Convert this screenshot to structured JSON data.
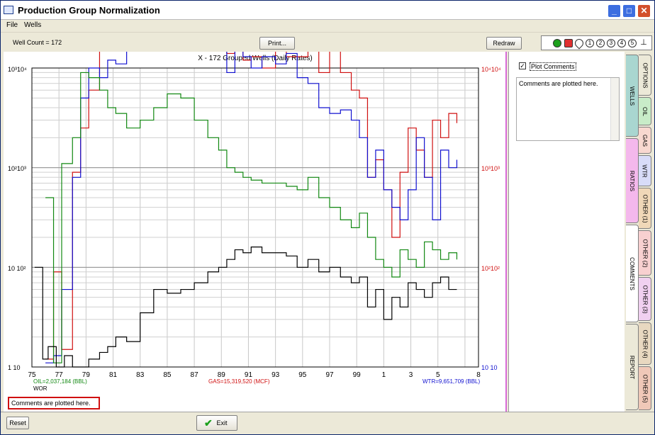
{
  "window": {
    "title": "Production Group Normalization"
  },
  "menu": {
    "file": "File",
    "wells": "Wells"
  },
  "toolbar": {
    "well_count": "Well Count = 172",
    "print_label": "Print...",
    "redraw_label": "Redraw"
  },
  "tools": [
    "green-circle-icon",
    "red-burst-icon",
    "drop-icon",
    "1",
    "2",
    "3",
    "4",
    "5",
    "pin-icon"
  ],
  "plot": {
    "title": "X - 172 Grouped Wells (Daily Rates)",
    "left_axis": [
      "10³10⁴",
      "10²10³",
      "10 10²",
      "1  10"
    ],
    "right_axis": [
      "10⁴10⁴",
      "10³10³",
      "10²10²",
      "10 10"
    ],
    "oil_label": "OIL=2,037,184 (BBL)",
    "wor_label": "WOR",
    "gas_label": "GAS=15,319,520 (MCF)",
    "wtr_label": "WTR=9,651,709 (BBL)",
    "comment": "Comments are plotted here."
  },
  "chart_data": {
    "type": "line",
    "title": "X - 172 Grouped Wells (Daily Rates)",
    "x_ticks": [
      "75",
      "77",
      "79",
      "81",
      "83",
      "85",
      "87",
      "89",
      "91",
      "93",
      "95",
      "97",
      "99",
      "1",
      "3",
      "5",
      "8"
    ],
    "x_range": [
      1975,
      2008
    ],
    "y_log_decades": 3,
    "series": [
      {
        "name": "GAS",
        "color": "#d01010",
        "x": [
          1976.0,
          1976.6,
          1977.2,
          1978.0,
          1978.6,
          1979.2,
          1980.0,
          1980.6,
          1981.2,
          1982.0,
          1983.0,
          1984.0,
          1985.0,
          1986.0,
          1987.0,
          1988.0,
          1988.8,
          1989.4,
          1990.0,
          1990.6,
          1991.2,
          1992.0,
          1993.0,
          1993.8,
          1994.6,
          1995.4,
          1996.2,
          1997.0,
          1997.8,
          1998.6,
          1999.2,
          1999.8,
          2000.4,
          2001.0,
          2001.6,
          2002.2,
          2002.8,
          2003.4,
          2004.0,
          2004.6,
          2005.2,
          2005.8,
          2006.4
        ],
        "y": [
          1.2,
          9,
          1.5,
          90,
          250,
          600,
          1700,
          1900,
          1800,
          2100,
          2300,
          2400,
          2500,
          2300,
          2500,
          2600,
          2800,
          1400,
          1500,
          1200,
          1300,
          1000,
          1900,
          1300,
          1300,
          1800,
          900,
          1500,
          900,
          600,
          500,
          80,
          120,
          60,
          20,
          90,
          250,
          150,
          80,
          300,
          200,
          350,
          280
        ]
      },
      {
        "name": "WTR",
        "color": "#1010d0",
        "x": [
          1976.0,
          1976.6,
          1977.2,
          1978.0,
          1978.6,
          1979.2,
          1980.0,
          1980.6,
          1981.2,
          1982.0,
          1983.0,
          1984.0,
          1985.0,
          1986.0,
          1987.0,
          1988.0,
          1988.8,
          1989.4,
          1990.0,
          1990.6,
          1991.2,
          1992.0,
          1993.0,
          1993.8,
          1994.6,
          1995.4,
          1996.2,
          1997.0,
          1997.8,
          1998.6,
          1999.2,
          1999.8,
          2000.4,
          2001.0,
          2001.6,
          2002.2,
          2002.8,
          2003.4,
          2004.0,
          2004.6,
          2005.2,
          2005.8,
          2006.4
        ],
        "y": [
          1.1,
          1.3,
          6,
          80,
          500,
          1000,
          800,
          1200,
          1100,
          1500,
          1900,
          2300,
          2500,
          2400,
          2100,
          1800,
          1600,
          900,
          1500,
          1300,
          1000,
          1300,
          1100,
          1400,
          800,
          700,
          400,
          350,
          380,
          300,
          200,
          80,
          150,
          60,
          40,
          30,
          60,
          200,
          80,
          30,
          150,
          100,
          120
        ]
      },
      {
        "name": "OIL",
        "color": "#118811",
        "x": [
          1976.0,
          1976.6,
          1977.2,
          1978.0,
          1978.6,
          1979.2,
          1980.0,
          1980.6,
          1981.2,
          1982.0,
          1983.0,
          1984.0,
          1985.0,
          1986.0,
          1987.0,
          1988.0,
          1988.8,
          1989.4,
          1990.0,
          1990.6,
          1991.2,
          1992.0,
          1993.0,
          1993.8,
          1994.6,
          1995.4,
          1996.2,
          1997.0,
          1997.8,
          1998.6,
          1999.2,
          1999.8,
          2000.4,
          2001.0,
          2001.6,
          2002.2,
          2002.8,
          2003.4,
          2004.0,
          2004.6,
          2005.2,
          2005.8,
          2006.4
        ],
        "y": [
          50,
          1.1,
          110,
          200,
          900,
          800,
          600,
          400,
          350,
          250,
          300,
          400,
          550,
          500,
          300,
          200,
          150,
          100,
          90,
          80,
          75,
          70,
          70,
          65,
          60,
          80,
          50,
          40,
          30,
          25,
          35,
          20,
          12,
          10,
          8,
          15,
          12,
          10,
          18,
          15,
          12,
          14,
          12
        ]
      },
      {
        "name": "WOR",
        "color": "#000000",
        "x": [
          1975.2,
          1975.8,
          1976.2,
          1976.8,
          1977.4,
          1978.0,
          1978.6,
          1979.2,
          1980.0,
          1980.6,
          1981.2,
          1982.0,
          1983.0,
          1984.0,
          1985.0,
          1986.0,
          1987.0,
          1988.0,
          1988.8,
          1989.4,
          1990.0,
          1990.6,
          1991.2,
          1992.0,
          1993.0,
          1993.8,
          1994.6,
          1995.4,
          1996.2,
          1997.0,
          1997.8,
          1998.6,
          1999.2,
          1999.8,
          2000.4,
          2001.0,
          2001.6,
          2002.2,
          2002.8,
          2003.4,
          2004.0,
          2004.6,
          2005.2,
          2005.8,
          2006.4
        ],
        "y": [
          10,
          1.2,
          1.6,
          1,
          1.3,
          1,
          1,
          1.2,
          1.4,
          1.6,
          2,
          1.8,
          3.5,
          6,
          5.5,
          6,
          7,
          9,
          10,
          12,
          15,
          14,
          16,
          14,
          14,
          13,
          10,
          12,
          9,
          10,
          8,
          7,
          8,
          4,
          6,
          3,
          5,
          4,
          7,
          6,
          5,
          7,
          8,
          6,
          6
        ]
      }
    ]
  },
  "sidepanel": {
    "plot_comments_label": "Plot Comments",
    "comment_text": "Comments are plotted here."
  },
  "tabs": {
    "options": "OPTIONS",
    "oil": "OIL",
    "gas": "GAS",
    "wtr": "WTR",
    "other1": "OTHER (1)",
    "other2": "OTHER (2)",
    "other3": "OTHER (3)",
    "other4": "OTHER (4)",
    "other5": "OTHER (5)",
    "wells": "WELLS",
    "ratios": "RATIOS",
    "comments": "COMMENTS",
    "report": "REPORT"
  },
  "footer": {
    "reset_label": "Reset",
    "exit_label": "Exit"
  }
}
